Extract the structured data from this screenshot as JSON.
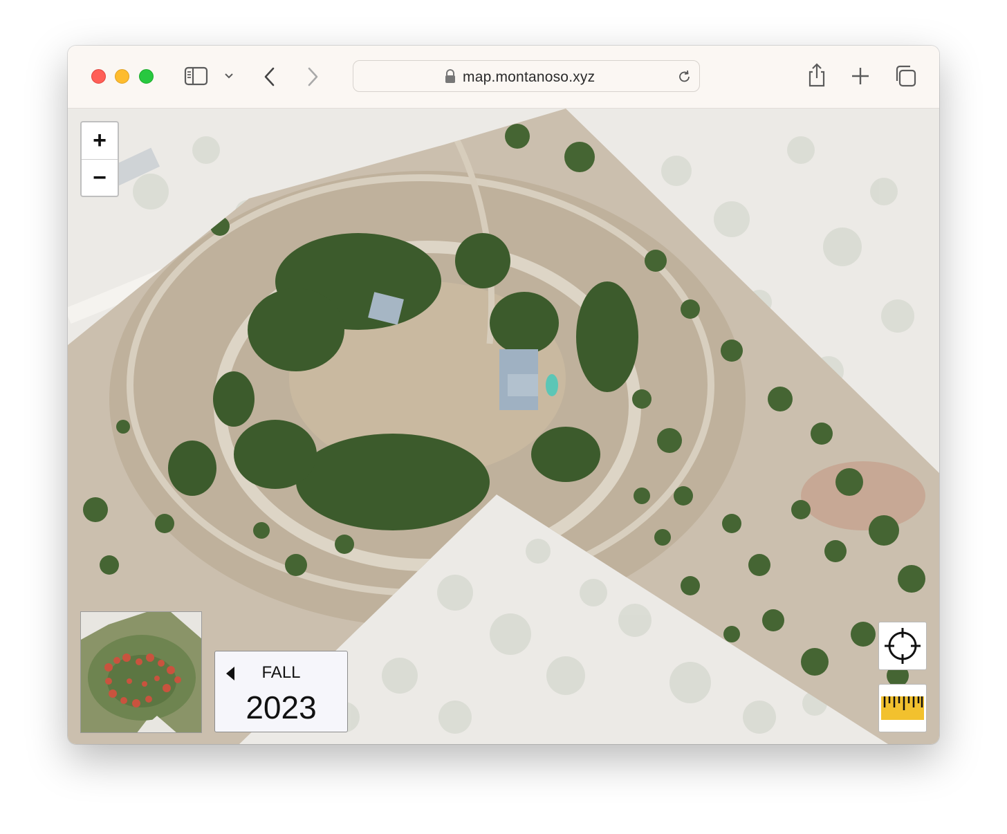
{
  "browser": {
    "url": "map.montanoso.xyz",
    "icons": [
      "sidebar-icon",
      "chevron-down-icon",
      "back-icon",
      "forward-icon",
      "lock-icon",
      "reload-icon",
      "share-icon",
      "new-tab-icon",
      "tabs-overview-icon"
    ]
  },
  "map": {
    "zoom_in_label": "+",
    "zoom_out_label": "−",
    "season": {
      "label": "FALL",
      "year": "2023"
    },
    "controls": [
      "crosshair-icon",
      "ruler-icon"
    ]
  },
  "colors": {
    "toolbar_bg": "#fbf7f3",
    "ruler_yellow": "#f2c12e",
    "canopy_green": "#3c5b2c",
    "bare_ground": "#cbbfae",
    "fade_overlay": "#eceae6"
  }
}
